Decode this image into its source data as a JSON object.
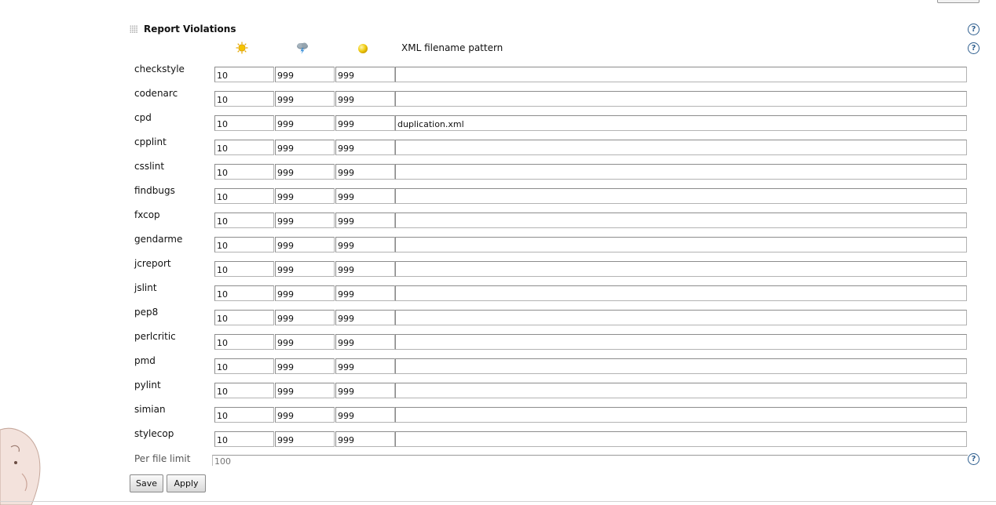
{
  "section": {
    "title": "Report Violations"
  },
  "header": {
    "sunny_icon": "sun-icon",
    "cloudy_icon": "thunderstorm-icon",
    "unstable_icon": "yellow-ball-icon",
    "pattern_label": "XML filename pattern"
  },
  "rows": [
    {
      "label": "checkstyle",
      "sunny": "10",
      "stormy": "999",
      "unstable": "999",
      "pattern": ""
    },
    {
      "label": "codenarc",
      "sunny": "10",
      "stormy": "999",
      "unstable": "999",
      "pattern": ""
    },
    {
      "label": "cpd",
      "sunny": "10",
      "stormy": "999",
      "unstable": "999",
      "pattern": "duplication.xml"
    },
    {
      "label": "cpplint",
      "sunny": "10",
      "stormy": "999",
      "unstable": "999",
      "pattern": ""
    },
    {
      "label": "csslint",
      "sunny": "10",
      "stormy": "999",
      "unstable": "999",
      "pattern": ""
    },
    {
      "label": "findbugs",
      "sunny": "10",
      "stormy": "999",
      "unstable": "999",
      "pattern": ""
    },
    {
      "label": "fxcop",
      "sunny": "10",
      "stormy": "999",
      "unstable": "999",
      "pattern": ""
    },
    {
      "label": "gendarme",
      "sunny": "10",
      "stormy": "999",
      "unstable": "999",
      "pattern": ""
    },
    {
      "label": "jcreport",
      "sunny": "10",
      "stormy": "999",
      "unstable": "999",
      "pattern": ""
    },
    {
      "label": "jslint",
      "sunny": "10",
      "stormy": "999",
      "unstable": "999",
      "pattern": ""
    },
    {
      "label": "pep8",
      "sunny": "10",
      "stormy": "999",
      "unstable": "999",
      "pattern": ""
    },
    {
      "label": "perlcritic",
      "sunny": "10",
      "stormy": "999",
      "unstable": "999",
      "pattern": ""
    },
    {
      "label": "pmd",
      "sunny": "10",
      "stormy": "999",
      "unstable": "999",
      "pattern": ""
    },
    {
      "label": "pylint",
      "sunny": "10",
      "stormy": "999",
      "unstable": "999",
      "pattern": ""
    },
    {
      "label": "simian",
      "sunny": "10",
      "stormy": "999",
      "unstable": "999",
      "pattern": ""
    },
    {
      "label": "stylecop",
      "sunny": "10",
      "stormy": "999",
      "unstable": "999",
      "pattern": ""
    }
  ],
  "per_file": {
    "label": "Per file limit",
    "placeholder": "100"
  },
  "buttons": {
    "save": "Save",
    "apply": "Apply"
  },
  "icons": {
    "help": "help-icon",
    "grip": "drag-handle-icon",
    "logo": "jenkins-butler-logo"
  },
  "colors": {
    "help_accent": "#2f5f8f",
    "sun": "#f5c400"
  }
}
